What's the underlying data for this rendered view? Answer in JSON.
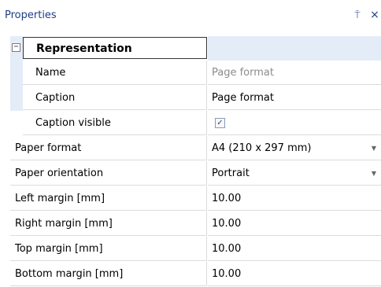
{
  "panel": {
    "title": "Properties",
    "pin_glyph": "⍑",
    "close_glyph": "×",
    "pin_icon": "pin-icon",
    "close_icon": "close-icon"
  },
  "category": {
    "label": "Representation",
    "toggle": "−"
  },
  "rows": [
    {
      "label": "Name",
      "value": "Page format"
    },
    {
      "label": "Caption",
      "value": "Page format"
    },
    {
      "label": "Caption visible",
      "value": "✓"
    },
    {
      "label": "Paper format",
      "value": "A4 (210 x 297 mm)",
      "dropdown": "▼"
    },
    {
      "label": "Paper orientation",
      "value": "Portrait",
      "dropdown": "▼"
    },
    {
      "label": "Left margin [mm]",
      "value": "10.00"
    },
    {
      "label": "Right margin [mm]",
      "value": "10.00"
    },
    {
      "label": "Top margin [mm]",
      "value": "10.00"
    },
    {
      "label": "Bottom margin [mm]",
      "value": "10.00"
    }
  ],
  "colors": {
    "title": "#1e3e85",
    "category_band": "#e4ecf7",
    "readonly_value": "#8c8c8c",
    "gridline": "#dcdcdc"
  }
}
